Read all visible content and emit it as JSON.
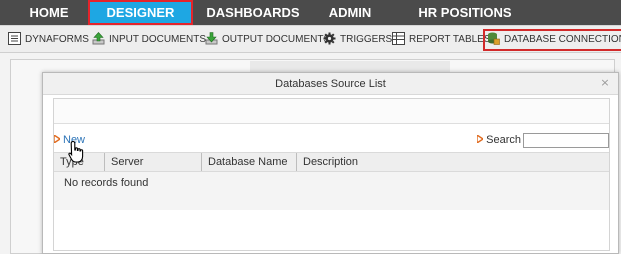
{
  "nav": {
    "tabs": [
      {
        "label": "HOME"
      },
      {
        "label": "DESIGNER"
      },
      {
        "label": "DASHBOARDS"
      },
      {
        "label": "ADMIN"
      },
      {
        "label": "HR POSITIONS"
      }
    ],
    "active": "DESIGNER",
    "active_color": "#1ea7e3",
    "highlight_color": "#e5242b"
  },
  "toolbar": {
    "items": [
      {
        "label": "DYNAFORMS",
        "icon": "form-icon"
      },
      {
        "label": "INPUT DOCUMENTS",
        "icon": "upload-arrow-icon"
      },
      {
        "label": "OUTPUT DOCUMENTS",
        "icon": "download-arrow-icon"
      },
      {
        "label": "TRIGGERS",
        "icon": "gear-icon"
      },
      {
        "label": "REPORT TABLES",
        "icon": "table-icon"
      },
      {
        "label": "DATABASE CONNECTIONS",
        "icon": "database-icon"
      }
    ]
  },
  "modal": {
    "title": "Databases Source List",
    "close": "×",
    "new_label": "New",
    "search_label": "Search",
    "search_value": "",
    "columns": [
      "Type",
      "Server",
      "Database Name",
      "Description"
    ],
    "empty_text": "No records found"
  }
}
